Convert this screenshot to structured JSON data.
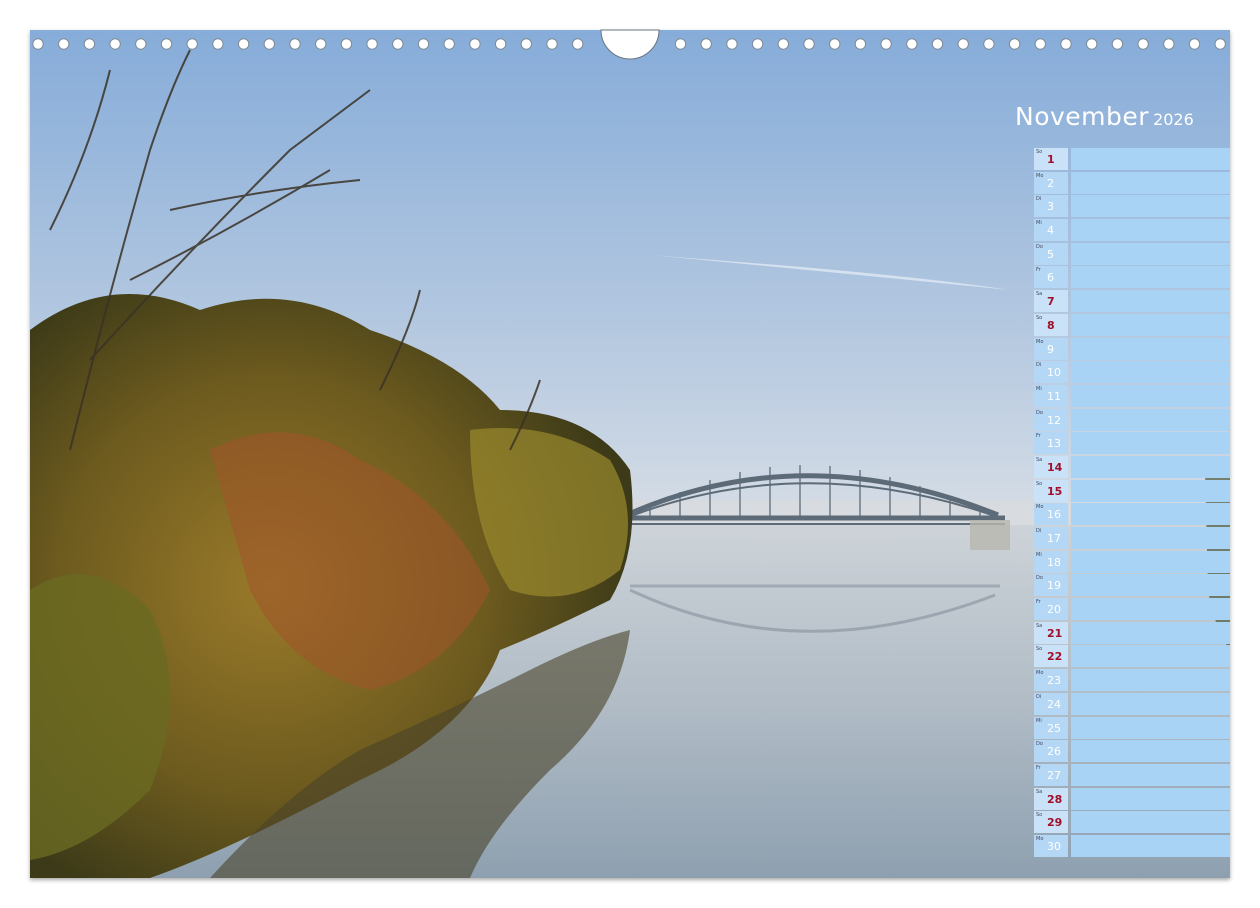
{
  "calendar": {
    "month": "November",
    "year": "2026",
    "days": [
      {
        "day": "1",
        "weekday": "So",
        "sunday": true
      },
      {
        "day": "2",
        "weekday": "Mo",
        "sunday": false
      },
      {
        "day": "3",
        "weekday": "Di",
        "sunday": false
      },
      {
        "day": "4",
        "weekday": "Mi",
        "sunday": false
      },
      {
        "day": "5",
        "weekday": "Do",
        "sunday": false
      },
      {
        "day": "6",
        "weekday": "Fr",
        "sunday": false
      },
      {
        "day": "7",
        "weekday": "Sa",
        "sunday": true
      },
      {
        "day": "8",
        "weekday": "So",
        "sunday": true
      },
      {
        "day": "9",
        "weekday": "Mo",
        "sunday": false
      },
      {
        "day": "10",
        "weekday": "Di",
        "sunday": false
      },
      {
        "day": "11",
        "weekday": "Mi",
        "sunday": false
      },
      {
        "day": "12",
        "weekday": "Do",
        "sunday": false
      },
      {
        "day": "13",
        "weekday": "Fr",
        "sunday": false
      },
      {
        "day": "14",
        "weekday": "Sa",
        "sunday": true
      },
      {
        "day": "15",
        "weekday": "So",
        "sunday": true
      },
      {
        "day": "16",
        "weekday": "Mo",
        "sunday": false
      },
      {
        "day": "17",
        "weekday": "Di",
        "sunday": false
      },
      {
        "day": "18",
        "weekday": "Mi",
        "sunday": false
      },
      {
        "day": "19",
        "weekday": "Do",
        "sunday": false
      },
      {
        "day": "20",
        "weekday": "Fr",
        "sunday": false
      },
      {
        "day": "21",
        "weekday": "Sa",
        "sunday": true
      },
      {
        "day": "22",
        "weekday": "So",
        "sunday": true
      },
      {
        "day": "23",
        "weekday": "Mo",
        "sunday": false
      },
      {
        "day": "24",
        "weekday": "Di",
        "sunday": false
      },
      {
        "day": "25",
        "weekday": "Mi",
        "sunday": false
      },
      {
        "day": "26",
        "weekday": "Do",
        "sunday": false
      },
      {
        "day": "27",
        "weekday": "Fr",
        "sunday": false
      },
      {
        "day": "28",
        "weekday": "Sa",
        "sunday": true
      },
      {
        "day": "29",
        "weekday": "So",
        "sunday": true
      },
      {
        "day": "30",
        "weekday": "Mo",
        "sunday": false
      }
    ]
  },
  "photo": {
    "subject": "arch-bridge-over-misty-river-with-autumn-trees",
    "colors": {
      "sky_top": "#8fb2dc",
      "sky_bottom": "#dfe3e8",
      "water": "#a9b4bf",
      "foliage": "#8a6a24",
      "bridge": "#5a6a7a"
    }
  }
}
